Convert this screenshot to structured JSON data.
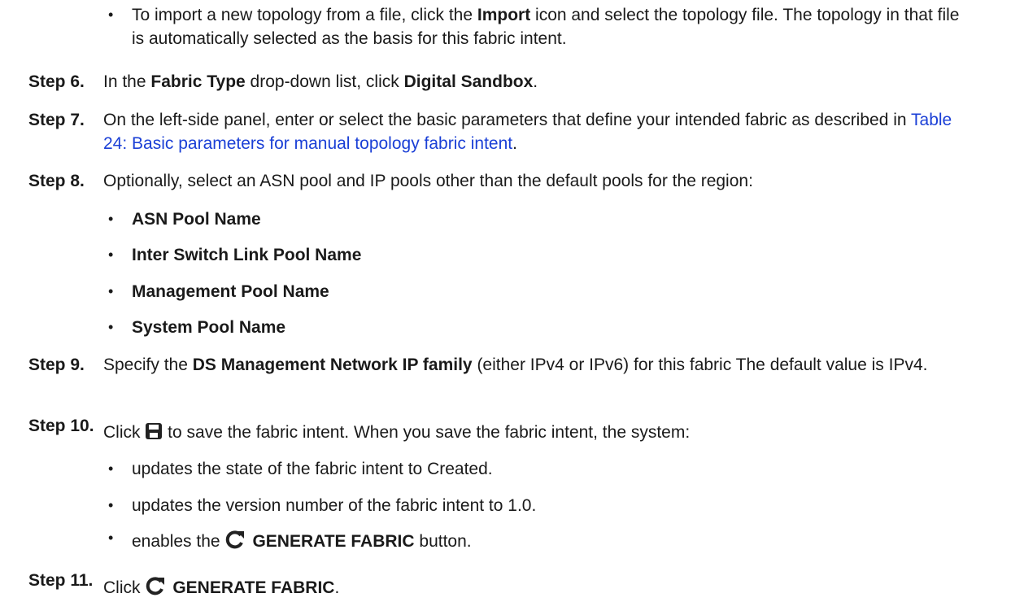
{
  "intro_bullet": {
    "pre": "To import a new topology from a file, click the ",
    "bold": "Import",
    "post": " icon and select the topology file. The topology in that file is automatically selected as the basis for this fabric intent."
  },
  "steps": {
    "s6": {
      "label": "Step 6.",
      "pre": "In the ",
      "bold1": "Fabric Type",
      "mid": " drop-down list, click ",
      "bold2": "Digital Sandbox",
      "post": "."
    },
    "s7": {
      "label": "Step 7.",
      "pre": "On the left-side panel, enter or select the basic parameters that define your intended fabric as described in ",
      "link": "Table 24: Basic parameters for manual topology fabric intent",
      "post": "."
    },
    "s8": {
      "label": "Step 8.",
      "text": "Optionally, select an ASN pool and IP pools other than the default pools for the region:",
      "items": [
        "ASN Pool Name",
        "Inter Switch Link Pool Name",
        "Management Pool Name",
        "System Pool Name"
      ]
    },
    "s9": {
      "label": "Step 9.",
      "pre": "Specify the ",
      "bold": "DS Management Network IP family",
      "post": " (either IPv4 or IPv6) for this fabric The default value is IPv4."
    },
    "s10": {
      "label": "Step 10.",
      "pre": "Click ",
      "post": " to save the fabric intent. When you save the fabric intent, the system:",
      "items": [
        "updates the state of the fabric intent to Created.",
        "updates the version number of the fabric intent to 1.0."
      ],
      "last_pre": "enables the ",
      "last_bold": "GENERATE FABRIC",
      "last_post": " button."
    },
    "s11": {
      "label": "Step 11.",
      "pre": "Click ",
      "bold": "GENERATE FABRIC",
      "post": "."
    }
  },
  "bullet_char": "•",
  "colors": {
    "text": "#1a1a1a",
    "link": "#1a3fd6"
  },
  "icons": [
    "save-icon",
    "regenerate-icon"
  ]
}
